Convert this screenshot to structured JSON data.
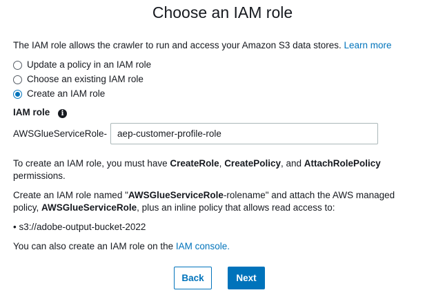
{
  "title": "Choose an IAM role",
  "intro": {
    "text": "The IAM role allows the crawler to run and access your Amazon S3 data stores.",
    "link": "Learn more"
  },
  "radios": [
    {
      "label": "Update a policy in an IAM role",
      "checked": false
    },
    {
      "label": "Choose an existing IAM role",
      "checked": false
    },
    {
      "label": "Create an IAM role",
      "checked": true
    }
  ],
  "iam_role": {
    "label": "IAM role",
    "info_icon": "info-icon",
    "prefix": "AWSGlueServiceRole-",
    "value": "aep-customer-profile-role"
  },
  "permissions": {
    "pre": "To create an IAM role, you must have",
    "create_role": "CreateRole",
    "sep1": ",",
    "create_policy": "CreatePolicy",
    "sep2": ", and",
    "attach_policy": "AttachRolePolicy",
    "line2": "permissions."
  },
  "create_note": {
    "pre": "Create an IAM role named \"",
    "bold_name": "AWSGlueServiceRole",
    "post": "-rolename\" and attach the AWS managed",
    "line2_pre": "policy,",
    "bold_policy": "AWSGlueServiceRole",
    "line2_post": ", plus an inline policy that allows read access to:"
  },
  "bucket": {
    "bullet": "•",
    "path": "s3://adobe-output-bucket-2022"
  },
  "console": {
    "text": "You can also create an IAM role on the",
    "link": "IAM console."
  },
  "buttons": {
    "back": "Back",
    "next": "Next"
  },
  "colors": {
    "accent": "#0073bb",
    "text": "#16191f"
  }
}
